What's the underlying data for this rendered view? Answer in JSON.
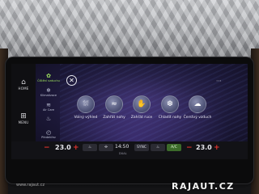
{
  "rail": {
    "home_label": "HOME",
    "menu_label": "MENU",
    "home_icon": "home-icon",
    "menu_icon": "grid-icon"
  },
  "menu": {
    "items": [
      {
        "label": "Čištění vzduchu",
        "icon": "air-purifier-icon",
        "active": true
      },
      {
        "label": "Klimatizace",
        "icon": "snowflake-icon",
        "active": false
      },
      {
        "label": "Air Care",
        "icon": "air-care-icon",
        "active": false
      },
      {
        "label": "",
        "icon": "seat-heat-icon",
        "active": false
      },
      {
        "label": "Předehřev",
        "icon": "preheat-icon",
        "active": false
      }
    ]
  },
  "tiles": [
    {
      "label": "Volný výhled",
      "icon": "defrost-windshield-icon"
    },
    {
      "label": "Zahřát nohy",
      "icon": "warm-feet-icon"
    },
    {
      "label": "Zahřát ruce",
      "icon": "warm-hands-icon"
    },
    {
      "label": "Chladit nohy",
      "icon": "cool-feet-icon"
    },
    {
      "label": "Čerstvý vzduch",
      "icon": "fresh-air-icon"
    }
  ],
  "climate_bar": {
    "left_temp": "23.0",
    "right_temp": "23.0",
    "minus": "−",
    "plus": "+",
    "left_chip_sub": "PŘEDNÍ",
    "sync_label": "SYNC",
    "time": "14:50",
    "center_sub": "DUAL",
    "ac_label": "A/C"
  },
  "watermark": {
    "text": "RAJAUT.CZ",
    "badge": "www.rajaut.cz"
  },
  "colors": {
    "accent_green": "#9fe35f",
    "temp_red": "#e3332e"
  }
}
